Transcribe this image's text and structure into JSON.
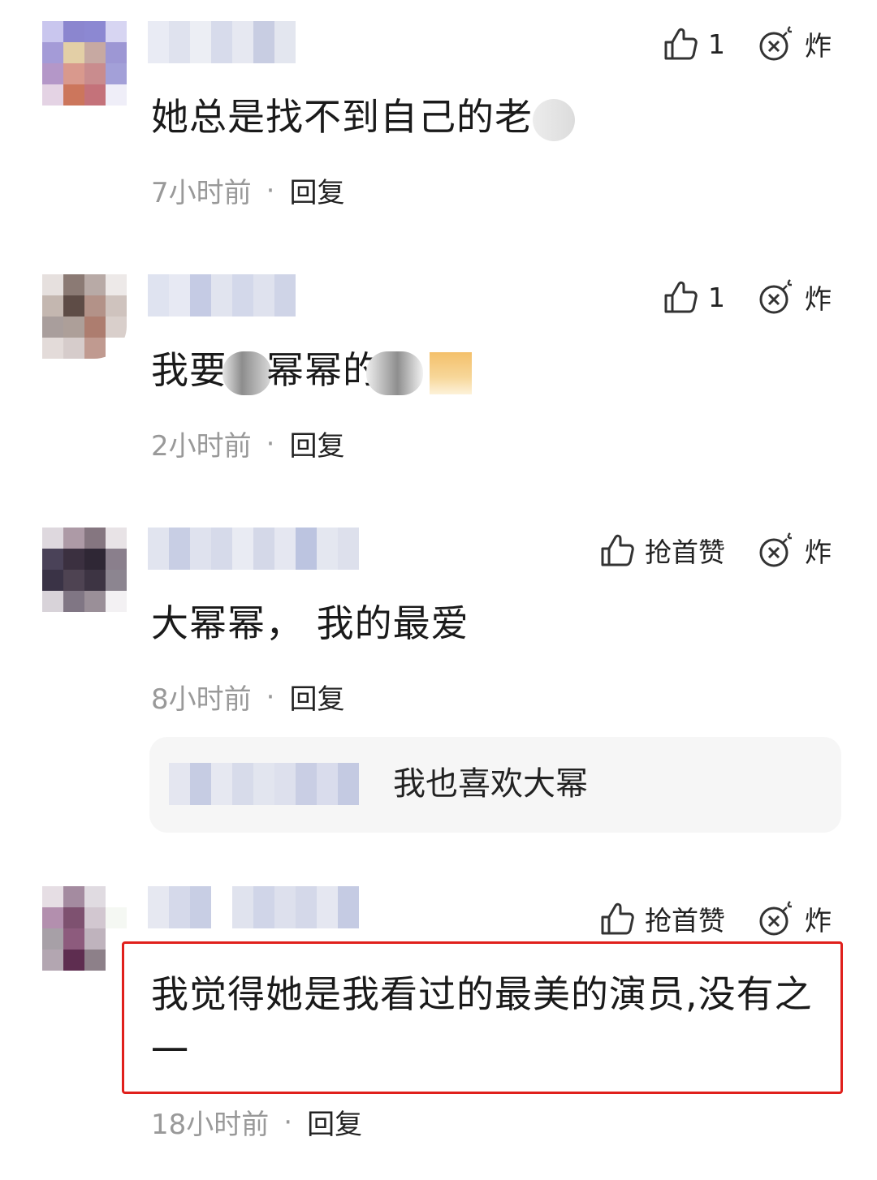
{
  "comments": [
    {
      "text": "她总是找不到自己的老",
      "time": "7小时前",
      "reply": "回复",
      "like_label": "1",
      "bomb_label": "炸"
    },
    {
      "text_a": "我要",
      "text_b": "幂幂的",
      "time": "2小时前",
      "reply": "回复",
      "like_label": "1",
      "bomb_label": "炸"
    },
    {
      "text": "大幂幂， 我的最爱",
      "time": "8小时前",
      "reply": "回复",
      "like_label": "抢首赞",
      "bomb_label": "炸",
      "sub_reply": {
        "text": "我也喜欢大幂"
      }
    },
    {
      "text": "我觉得她是我看过的最美的演员,没有之一",
      "time": "18小时前",
      "reply": "回复",
      "like_label": "抢首赞",
      "bomb_label": "炸"
    }
  ],
  "separator": "·",
  "icons": {
    "like": "thumbs-up-icon",
    "bomb": "bomb-icon"
  },
  "colors": {
    "highlight": "#e0201c",
    "meta": "#999999",
    "reply_bg": "#f6f6f6"
  }
}
